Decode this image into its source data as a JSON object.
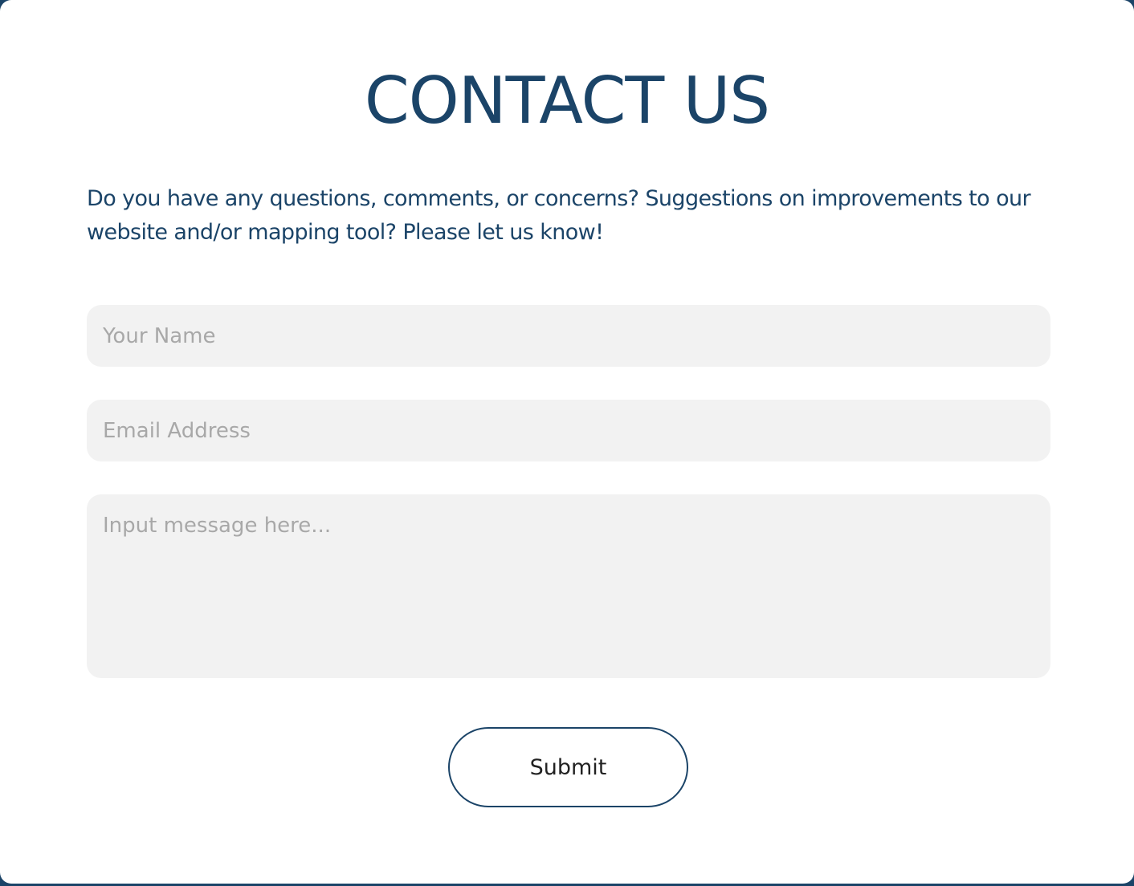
{
  "form": {
    "title": "CONTACT US",
    "intro": "Do you have any questions, comments, or concerns? Suggestions on improvements to our website and/or mapping tool? Please let us know!",
    "name_placeholder": "Your Name",
    "email_placeholder": "Email Address",
    "message_placeholder": "Input message here...",
    "submit_label": "Submit"
  },
  "colors": {
    "accent": "#1b4468",
    "field_background": "#f2f2f2",
    "placeholder_text": "#a8a8a8"
  }
}
